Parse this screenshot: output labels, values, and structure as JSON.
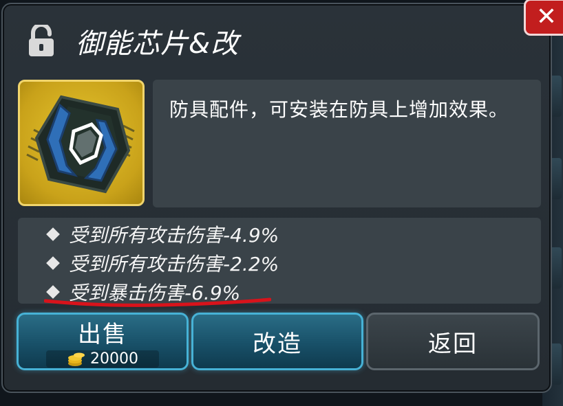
{
  "header": {
    "title": "御能芯片&改"
  },
  "item": {
    "description": "防具配件，可安装在防具上增加效果。"
  },
  "stats": [
    {
      "text": "受到所有攻击伤害-4.9%"
    },
    {
      "text": "受到所有攻击伤害-2.2%"
    },
    {
      "text": "受到暴击伤害-6.9%"
    }
  ],
  "buttons": {
    "sell": {
      "label": "出售",
      "price": "20000"
    },
    "upgrade": {
      "label": "改造"
    },
    "back": {
      "label": "返回"
    }
  },
  "colors": {
    "accent_blue": "#47b2d6",
    "item_gold": "#e6c52e",
    "close_red": "#c21e1e",
    "underline_red": "#d8131b"
  },
  "icons": [
    "lock-open-icon",
    "close-icon",
    "chip-item-icon",
    "coin-stack-icon",
    "diamond-bullet-icon"
  ]
}
